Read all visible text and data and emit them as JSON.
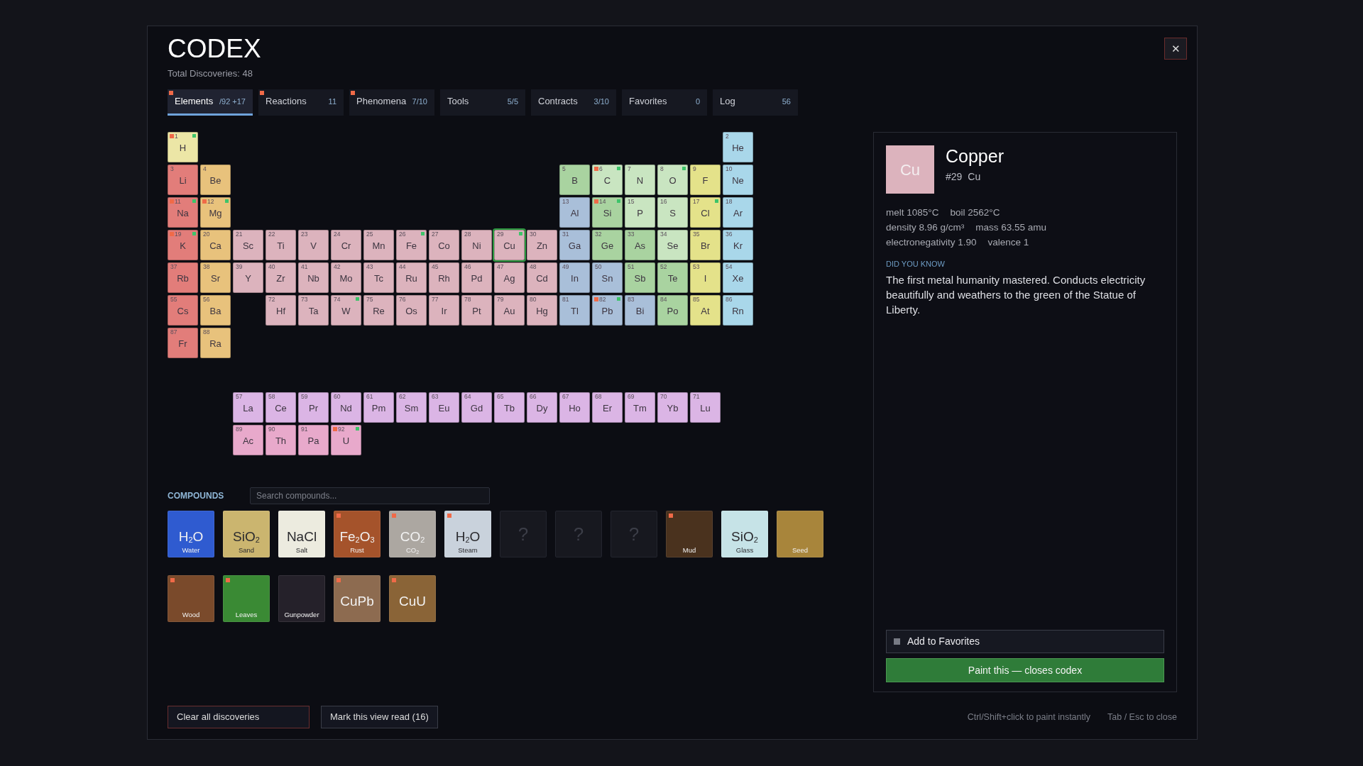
{
  "header": {
    "title": "CODEX",
    "subtitle": "Total Discoveries: 48",
    "close": "✕"
  },
  "tabs": [
    {
      "label": "Elements",
      "count": "/92",
      "extra": "+17",
      "new": true,
      "selected": true
    },
    {
      "label": "Reactions",
      "count": "11",
      "new": true,
      "selected": false
    },
    {
      "label": "Phenomena",
      "count": "7/10",
      "new": true,
      "selected": false
    },
    {
      "label": "Tools",
      "count": "5/5",
      "new": false,
      "selected": false
    },
    {
      "label": "Contracts",
      "count": "3/10",
      "new": false,
      "selected": false
    },
    {
      "label": "Favorites",
      "count": "0",
      "new": false,
      "selected": false
    },
    {
      "label": "Log",
      "count": "56",
      "new": false,
      "selected": false
    }
  ],
  "periodic_table": {
    "rows": [
      {
        "left": [
          {
            "number": "1",
            "symbol": "H",
            "color": "#ece6a6",
            "new": true,
            "pinned": true,
            "selected": false
          }
        ],
        "right": [
          {
            "number": "2",
            "symbol": "He",
            "color": "#a9d7ea",
            "new": false,
            "pinned": false,
            "selected": false
          }
        ]
      },
      {
        "left": [
          {
            "number": "3",
            "symbol": "Li",
            "color": "#e27d7a",
            "new": false,
            "pinned": false,
            "selected": false
          },
          {
            "number": "4",
            "symbol": "Be",
            "color": "#e8c27c",
            "new": false,
            "pinned": false,
            "selected": false
          }
        ],
        "right": [
          {
            "number": "5",
            "symbol": "B",
            "color": "#a9d3a0",
            "new": false,
            "pinned": false,
            "selected": false
          },
          {
            "number": "6",
            "symbol": "C",
            "color": "#c9e5c1",
            "new": true,
            "pinned": true,
            "selected": false
          },
          {
            "number": "7",
            "symbol": "N",
            "color": "#c9e5c1",
            "new": false,
            "pinned": false,
            "selected": false
          },
          {
            "number": "8",
            "symbol": "O",
            "color": "#c9e5c1",
            "new": false,
            "pinned": true,
            "selected": false
          },
          {
            "number": "9",
            "symbol": "F",
            "color": "#e4e28a",
            "new": false,
            "pinned": false,
            "selected": false
          },
          {
            "number": "10",
            "symbol": "Ne",
            "color": "#a9d7ea",
            "new": false,
            "pinned": false,
            "selected": false
          }
        ]
      },
      {
        "left": [
          {
            "number": "11",
            "symbol": "Na",
            "color": "#e27d7a",
            "new": true,
            "pinned": true,
            "selected": false
          },
          {
            "number": "12",
            "symbol": "Mg",
            "color": "#e8c27c",
            "new": true,
            "pinned": true,
            "selected": false
          }
        ],
        "right": [
          {
            "number": "13",
            "symbol": "Al",
            "color": "#a9bfd9",
            "new": false,
            "pinned": false,
            "selected": false
          },
          {
            "number": "14",
            "symbol": "Si",
            "color": "#a9d3a0",
            "new": true,
            "pinned": true,
            "selected": false
          },
          {
            "number": "15",
            "symbol": "P",
            "color": "#c9e5c1",
            "new": false,
            "pinned": false,
            "selected": false
          },
          {
            "number": "16",
            "symbol": "S",
            "color": "#c9e5c1",
            "new": false,
            "pinned": false,
            "selected": false
          },
          {
            "number": "17",
            "symbol": "Cl",
            "color": "#e4e28a",
            "new": false,
            "pinned": true,
            "selected": false
          },
          {
            "number": "18",
            "symbol": "Ar",
            "color": "#a9d7ea",
            "new": false,
            "pinned": false,
            "selected": false
          }
        ]
      },
      {
        "left": [
          {
            "number": "19",
            "symbol": "K",
            "color": "#e27d7a",
            "new": true,
            "pinned": true,
            "selected": false
          },
          {
            "number": "20",
            "symbol": "Ca",
            "color": "#e8c27c",
            "new": false,
            "pinned": false,
            "selected": false
          }
        ],
        "right": [
          {
            "number": "21",
            "symbol": "Sc",
            "color": "#dcb3bd",
            "new": false,
            "pinned": false,
            "selected": false
          },
          {
            "number": "22",
            "symbol": "Ti",
            "color": "#dcb3bd",
            "new": false,
            "pinned": false,
            "selected": false
          },
          {
            "number": "23",
            "symbol": "V",
            "color": "#dcb3bd",
            "new": false,
            "pinned": false,
            "selected": false
          },
          {
            "number": "24",
            "symbol": "Cr",
            "color": "#dcb3bd",
            "new": false,
            "pinned": false,
            "selected": false
          },
          {
            "number": "25",
            "symbol": "Mn",
            "color": "#dcb3bd",
            "new": false,
            "pinned": false,
            "selected": false
          },
          {
            "number": "26",
            "symbol": "Fe",
            "color": "#dcb3bd",
            "new": false,
            "pinned": true,
            "selected": false
          },
          {
            "number": "27",
            "symbol": "Co",
            "color": "#dcb3bd",
            "new": false,
            "pinned": false,
            "selected": false
          },
          {
            "number": "28",
            "symbol": "Ni",
            "color": "#dcb3bd",
            "new": false,
            "pinned": false,
            "selected": false
          },
          {
            "number": "29",
            "symbol": "Cu",
            "color": "#dcb3bd",
            "new": false,
            "pinned": true,
            "selected": true
          },
          {
            "number": "30",
            "symbol": "Zn",
            "color": "#dcb3bd",
            "new": false,
            "pinned": false,
            "selected": false
          },
          {
            "number": "31",
            "symbol": "Ga",
            "color": "#a9bfd9",
            "new": false,
            "pinned": false,
            "selected": false
          },
          {
            "number": "32",
            "symbol": "Ge",
            "color": "#a9d3a0",
            "new": false,
            "pinned": false,
            "selected": false
          },
          {
            "number": "33",
            "symbol": "As",
            "color": "#a9d3a0",
            "new": false,
            "pinned": false,
            "selected": false
          },
          {
            "number": "34",
            "symbol": "Se",
            "color": "#c9e5c1",
            "new": false,
            "pinned": false,
            "selected": false
          },
          {
            "number": "35",
            "symbol": "Br",
            "color": "#e4e28a",
            "new": false,
            "pinned": false,
            "selected": false
          },
          {
            "number": "36",
            "symbol": "Kr",
            "color": "#a9d7ea",
            "new": false,
            "pinned": false,
            "selected": false
          }
        ]
      },
      {
        "left": [
          {
            "number": "37",
            "symbol": "Rb",
            "color": "#e27d7a",
            "new": false,
            "pinned": false,
            "selected": false
          },
          {
            "number": "38",
            "symbol": "Sr",
            "color": "#e8c27c",
            "new": false,
            "pinned": false,
            "selected": false
          }
        ],
        "right": [
          {
            "number": "39",
            "symbol": "Y",
            "color": "#dcb3bd",
            "new": false,
            "pinned": false,
            "selected": false
          },
          {
            "number": "40",
            "symbol": "Zr",
            "color": "#dcb3bd",
            "new": false,
            "pinned": false,
            "selected": false
          },
          {
            "number": "41",
            "symbol": "Nb",
            "color": "#dcb3bd",
            "new": false,
            "pinned": false,
            "selected": false
          },
          {
            "number": "42",
            "symbol": "Mo",
            "color": "#dcb3bd",
            "new": false,
            "pinned": false,
            "selected": false
          },
          {
            "number": "43",
            "symbol": "Tc",
            "color": "#dcb3bd",
            "new": false,
            "pinned": false,
            "selected": false
          },
          {
            "number": "44",
            "symbol": "Ru",
            "color": "#dcb3bd",
            "new": false,
            "pinned": false,
            "selected": false
          },
          {
            "number": "45",
            "symbol": "Rh",
            "color": "#dcb3bd",
            "new": false,
            "pinned": false,
            "selected": false
          },
          {
            "number": "46",
            "symbol": "Pd",
            "color": "#dcb3bd",
            "new": false,
            "pinned": false,
            "selected": false
          },
          {
            "number": "47",
            "symbol": "Ag",
            "color": "#dcb3bd",
            "new": false,
            "pinned": false,
            "selected": false
          },
          {
            "number": "48",
            "symbol": "Cd",
            "color": "#dcb3bd",
            "new": false,
            "pinned": false,
            "selected": false
          },
          {
            "number": "49",
            "symbol": "In",
            "color": "#a9bfd9",
            "new": false,
            "pinned": false,
            "selected": false
          },
          {
            "number": "50",
            "symbol": "Sn",
            "color": "#a9bfd9",
            "new": false,
            "pinned": false,
            "selected": false
          },
          {
            "number": "51",
            "symbol": "Sb",
            "color": "#a9d3a0",
            "new": false,
            "pinned": false,
            "selected": false
          },
          {
            "number": "52",
            "symbol": "Te",
            "color": "#a9d3a0",
            "new": false,
            "pinned": false,
            "selected": false
          },
          {
            "number": "53",
            "symbol": "I",
            "color": "#e4e28a",
            "new": false,
            "pinned": false,
            "selected": false
          },
          {
            "number": "54",
            "symbol": "Xe",
            "color": "#a9d7ea",
            "new": false,
            "pinned": false,
            "selected": false
          }
        ]
      },
      {
        "left": [
          {
            "number": "55",
            "symbol": "Cs",
            "color": "#e27d7a",
            "new": false,
            "pinned": false,
            "selected": false
          },
          {
            "number": "56",
            "symbol": "Ba",
            "color": "#e8c27c",
            "new": false,
            "pinned": false,
            "selected": false
          }
        ],
        "right": [
          {
            "number": "72",
            "symbol": "Hf",
            "color": "#dcb3bd",
            "new": false,
            "pinned": false,
            "selected": false
          },
          {
            "number": "73",
            "symbol": "Ta",
            "color": "#dcb3bd",
            "new": false,
            "pinned": false,
            "selected": false
          },
          {
            "number": "74",
            "symbol": "W",
            "color": "#dcb3bd",
            "new": false,
            "pinned": true,
            "selected": false
          },
          {
            "number": "75",
            "symbol": "Re",
            "color": "#dcb3bd",
            "new": false,
            "pinned": false,
            "selected": false
          },
          {
            "number": "76",
            "symbol": "Os",
            "color": "#dcb3bd",
            "new": false,
            "pinned": false,
            "selected": false
          },
          {
            "number": "77",
            "symbol": "Ir",
            "color": "#dcb3bd",
            "new": false,
            "pinned": false,
            "selected": false
          },
          {
            "number": "78",
            "symbol": "Pt",
            "color": "#dcb3bd",
            "new": false,
            "pinned": false,
            "selected": false
          },
          {
            "number": "79",
            "symbol": "Au",
            "color": "#dcb3bd",
            "new": false,
            "pinned": false,
            "selected": false
          },
          {
            "number": "80",
            "symbol": "Hg",
            "color": "#dcb3bd",
            "new": false,
            "pinned": false,
            "selected": false
          },
          {
            "number": "81",
            "symbol": "Tl",
            "color": "#a9bfd9",
            "new": false,
            "pinned": false,
            "selected": false
          },
          {
            "number": "82",
            "symbol": "Pb",
            "color": "#a9bfd9",
            "new": true,
            "pinned": true,
            "selected": false
          },
          {
            "number": "83",
            "symbol": "Bi",
            "color": "#a9bfd9",
            "new": false,
            "pinned": false,
            "selected": false
          },
          {
            "number": "84",
            "symbol": "Po",
            "color": "#a9d3a0",
            "new": false,
            "pinned": false,
            "selected": false
          },
          {
            "number": "85",
            "symbol": "At",
            "color": "#e4e28a",
            "new": false,
            "pinned": false,
            "selected": false
          },
          {
            "number": "86",
            "symbol": "Rn",
            "color": "#a9d7ea",
            "new": false,
            "pinned": false,
            "selected": false
          }
        ]
      },
      {
        "left": [
          {
            "number": "87",
            "symbol": "Fr",
            "color": "#e27d7a",
            "new": false,
            "pinned": false,
            "selected": false
          },
          {
            "number": "88",
            "symbol": "Ra",
            "color": "#e8c27c",
            "new": false,
            "pinned": false,
            "selected": false
          }
        ],
        "right": []
      }
    ],
    "f_block": [
      [
        {
          "number": "57",
          "symbol": "La",
          "color": "#dbb5e5",
          "new": false,
          "pinned": false,
          "selected": false
        },
        {
          "number": "58",
          "symbol": "Ce",
          "color": "#dbb5e5",
          "new": false,
          "pinned": false,
          "selected": false
        },
        {
          "number": "59",
          "symbol": "Pr",
          "color": "#dbb5e5",
          "new": false,
          "pinned": false,
          "selected": false
        },
        {
          "number": "60",
          "symbol": "Nd",
          "color": "#dbb5e5",
          "new": false,
          "pinned": false,
          "selected": false
        },
        {
          "number": "61",
          "symbol": "Pm",
          "color": "#dbb5e5",
          "new": false,
          "pinned": false,
          "selected": false
        },
        {
          "number": "62",
          "symbol": "Sm",
          "color": "#dbb5e5",
          "new": false,
          "pinned": false,
          "selected": false
        },
        {
          "number": "63",
          "symbol": "Eu",
          "color": "#dbb5e5",
          "new": false,
          "pinned": false,
          "selected": false
        },
        {
          "number": "64",
          "symbol": "Gd",
          "color": "#dbb5e5",
          "new": false,
          "pinned": false,
          "selected": false
        },
        {
          "number": "65",
          "symbol": "Tb",
          "color": "#dbb5e5",
          "new": false,
          "pinned": false,
          "selected": false
        },
        {
          "number": "66",
          "symbol": "Dy",
          "color": "#dbb5e5",
          "new": false,
          "pinned": false,
          "selected": false
        },
        {
          "number": "67",
          "symbol": "Ho",
          "color": "#dbb5e5",
          "new": false,
          "pinned": false,
          "selected": false
        },
        {
          "number": "68",
          "symbol": "Er",
          "color": "#dbb5e5",
          "new": false,
          "pinned": false,
          "selected": false
        },
        {
          "number": "69",
          "symbol": "Tm",
          "color": "#dbb5e5",
          "new": false,
          "pinned": false,
          "selected": false
        },
        {
          "number": "70",
          "symbol": "Yb",
          "color": "#dbb5e5",
          "new": false,
          "pinned": false,
          "selected": false
        },
        {
          "number": "71",
          "symbol": "Lu",
          "color": "#dbb5e5",
          "new": false,
          "pinned": false,
          "selected": false
        }
      ],
      [
        {
          "number": "89",
          "symbol": "Ac",
          "color": "#e8a9cb",
          "new": false,
          "pinned": false,
          "selected": false
        },
        {
          "number": "90",
          "symbol": "Th",
          "color": "#e8a9cb",
          "new": false,
          "pinned": false,
          "selected": false
        },
        {
          "number": "91",
          "symbol": "Pa",
          "color": "#e8a9cb",
          "new": false,
          "pinned": false,
          "selected": false
        },
        {
          "number": "92",
          "symbol": "U",
          "color": "#e8a9cb",
          "new": true,
          "pinned": true,
          "selected": false
        }
      ]
    ]
  },
  "compounds": {
    "title": "COMPOUNDS",
    "search": {
      "placeholder": "Search compounds..."
    },
    "items": [
      {
        "kind": "known",
        "formula": "H$_{2}$O",
        "label": "Water",
        "color": "#2f5bd0",
        "new": false
      },
      {
        "kind": "known",
        "formula": "SiO$_{2}$",
        "label": "Sand",
        "color": "#cbb56f",
        "new": false
      },
      {
        "kind": "known",
        "formula": "NaCl",
        "label": "Salt",
        "color": "#ecebdf",
        "new": false
      },
      {
        "kind": "known",
        "formula": "Fe$_{2}$O$_{3}$",
        "label": "Rust",
        "color": "#a5532b",
        "new": true
      },
      {
        "kind": "known",
        "formula": "CO$_{2}$",
        "label": "CO$_{2}$",
        "color": "#aca7a1",
        "new": true
      },
      {
        "kind": "known",
        "formula": "H$_{2}$O",
        "label": "Steam",
        "color": "#c9d2dc",
        "new": true
      },
      {
        "kind": "unknown",
        "formula": "?",
        "new": false
      },
      {
        "kind": "unknown",
        "formula": "?",
        "new": false
      },
      {
        "kind": "unknown",
        "formula": "?",
        "new": false
      },
      {
        "kind": "known",
        "label": "Mud",
        "color": "#4a321e",
        "new": true
      },
      {
        "kind": "known",
        "formula": "SiO$_{2}$",
        "label": "Glass",
        "color": "#c6e3e7",
        "new": false
      },
      {
        "kind": "known",
        "label": "Seed",
        "color": "#a8853b",
        "new": false
      },
      {
        "kind": "known",
        "label": "Wood",
        "color": "#7a4a2b",
        "new": true
      },
      {
        "kind": "known",
        "label": "Leaves",
        "color": "#3a8a34",
        "new": true
      },
      {
        "kind": "known",
        "label": "Gunpowder",
        "color": "#25212a",
        "new": false
      },
      {
        "kind": "known",
        "formula": "CuPb",
        "color": "#8d6b50",
        "new": true
      },
      {
        "kind": "known",
        "formula": "CuU",
        "color": "#8a6437",
        "new": true
      }
    ]
  },
  "detail": {
    "tile": "Cu",
    "color": "#dcb3bd",
    "name": "Copper",
    "number": "#29",
    "symbol": "Cu",
    "stats": [
      [
        "melt 1085°C",
        "boil 2562°C"
      ],
      [
        "density 8.96 g/cm³",
        "mass 63.55 amu"
      ],
      [
        "electronegativity 1.90",
        "valence 1"
      ]
    ],
    "fact_heading": "DID YOU KNOW",
    "fact": "The first metal humanity mastered. Conducts electricity beautifully and weathers to the green of the Statue of Liberty.",
    "favorite": {
      "label": "Add to Favorites",
      "checked": false
    },
    "paint": {
      "label": "Paint this — closes codex"
    }
  },
  "footer": {
    "buttons": [
      {
        "kind": "danger",
        "label": "Clear all discoveries"
      },
      {
        "kind": "default",
        "label": "Mark this view read (16)"
      }
    ],
    "hints": [
      "Ctrl/Shift+click to paint instantly",
      "Tab / Esc to close"
    ]
  }
}
